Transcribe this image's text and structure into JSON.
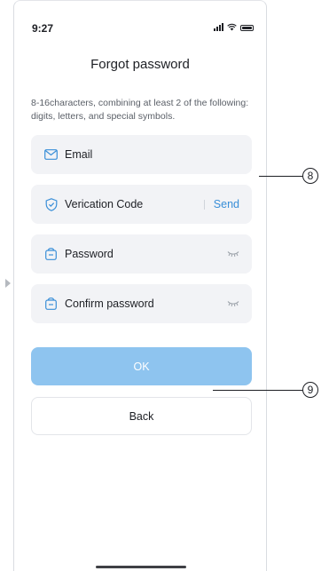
{
  "status_bar": {
    "time": "9:27"
  },
  "page": {
    "title": "Forgot password",
    "hint": "8-16characters, combining at least 2 of the following: digits, letters, and special symbols."
  },
  "fields": {
    "email": {
      "label": "Email",
      "icon": "mail-icon"
    },
    "code": {
      "label": "Verication Code",
      "icon": "shield-check-icon",
      "action": "Send"
    },
    "password": {
      "label": "Password",
      "icon": "lock-icon",
      "toggle_icon": "eye-closed-icon"
    },
    "confirm": {
      "label": "Confirm password",
      "icon": "lock-icon",
      "toggle_icon": "eye-closed-icon"
    }
  },
  "buttons": {
    "ok": "OK",
    "back": "Back"
  },
  "callouts": {
    "fields": "8",
    "buttons": "9"
  },
  "colors": {
    "accent": "#3a8fd8",
    "ok_button": "#8ec4ef",
    "field_bg": "#f2f3f6",
    "text": "#1d1f24"
  }
}
